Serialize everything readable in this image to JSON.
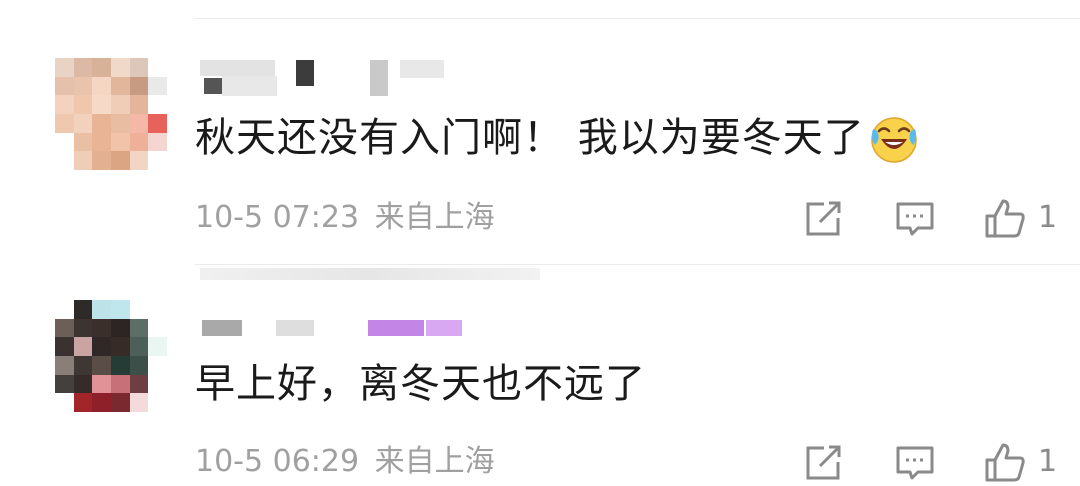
{
  "comments": [
    {
      "text": "秋天还没有入门啊！ 我以为要冬天了",
      "emoji": "laughing-crying-emoji",
      "date": "10-5 07:23",
      "location": "来自上海",
      "likes": "1"
    },
    {
      "text": "早上好，离冬天也不远了",
      "date": "10-5 06:29",
      "location": "来自上海",
      "likes": "1"
    }
  ],
  "icons": {
    "edit": "edit-icon",
    "reply": "reply-icon",
    "like": "thumbs-up-icon"
  },
  "colors": {
    "text": "#1a1a1a",
    "meta": "#a0a0a0",
    "icon": "#8a8a8a"
  }
}
